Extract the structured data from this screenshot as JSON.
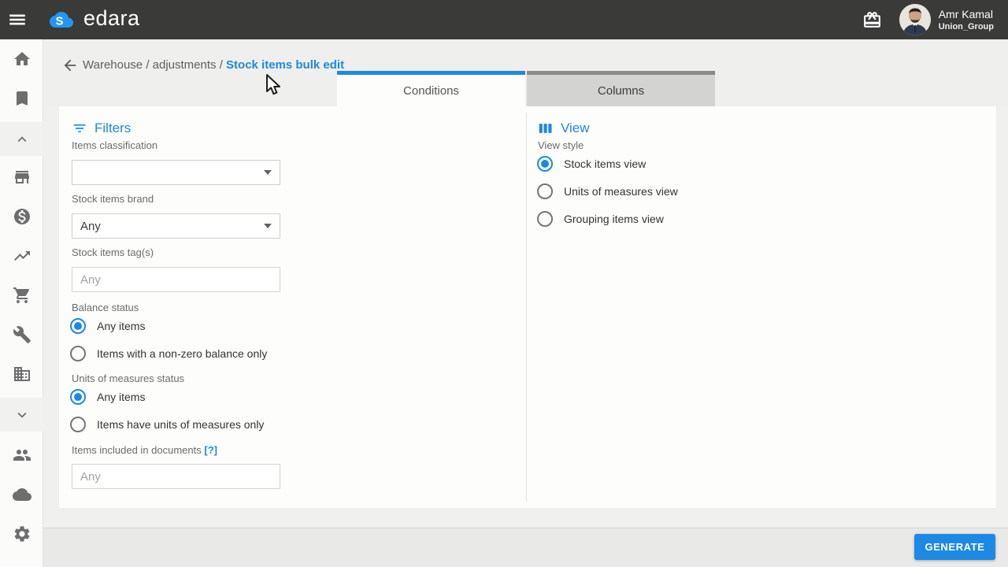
{
  "topbar": {
    "brand": "edara",
    "user": {
      "name": "Amr Kamal",
      "org": "Union_Group"
    }
  },
  "breadcrumb": {
    "path": "Warehouse / adjustments / ",
    "current": "Stock items bulk edit"
  },
  "tabs": {
    "conditions": "Conditions",
    "columns": "Columns",
    "active": "Conditions"
  },
  "filters": {
    "title": "Filters",
    "items_classification": {
      "label": "Items classification",
      "value": ""
    },
    "stock_items_brand": {
      "label": "Stock items brand",
      "value": "Any"
    },
    "stock_items_tags": {
      "label": "Stock items tag(s)",
      "placeholder": "Any",
      "value": ""
    },
    "balance_status": {
      "label": "Balance status",
      "options": [
        "Any items",
        "Items with a non-zero balance only"
      ],
      "selected": "Any items"
    },
    "units_of_measures_status": {
      "label": "Units of measures status",
      "options": [
        "Any items",
        "Items have units of measures only"
      ],
      "selected": "Any items"
    },
    "items_included_in_documents": {
      "label": "Items included in documents",
      "help_badge": "[?]",
      "placeholder": "Any",
      "value": ""
    }
  },
  "view": {
    "title": "View",
    "style_label": "View style",
    "options": [
      "Stock items view",
      "Units of measures view",
      "Grouping items view"
    ],
    "selected": "Stock items view"
  },
  "footer": {
    "generate_label": "GENERATE"
  },
  "colors": {
    "accent": "#1e88e5",
    "topbar_bg": "#3a3a38",
    "page_bg": "#f0f0ee",
    "footer_bg": "#e9e9e7",
    "inactive_tab": "#d3d3d1"
  },
  "icons": {
    "topbar": [
      "menu-icon",
      "edara-cloud-logo",
      "gift-icon",
      "avatar"
    ],
    "sidebar": [
      "home-icon",
      "bookmark-icon",
      "chevron-up-icon",
      "store-icon",
      "money-icon",
      "trending-up-icon",
      "cart-icon",
      "wrench-icon",
      "building-icon",
      "chevron-down-icon",
      "people-icon",
      "cloud-icon",
      "gear-icon"
    ],
    "content": [
      "back-arrow-icon",
      "filter-icon",
      "columns-view-icon",
      "dropdown-caret-icon",
      "mouse-cursor"
    ]
  }
}
